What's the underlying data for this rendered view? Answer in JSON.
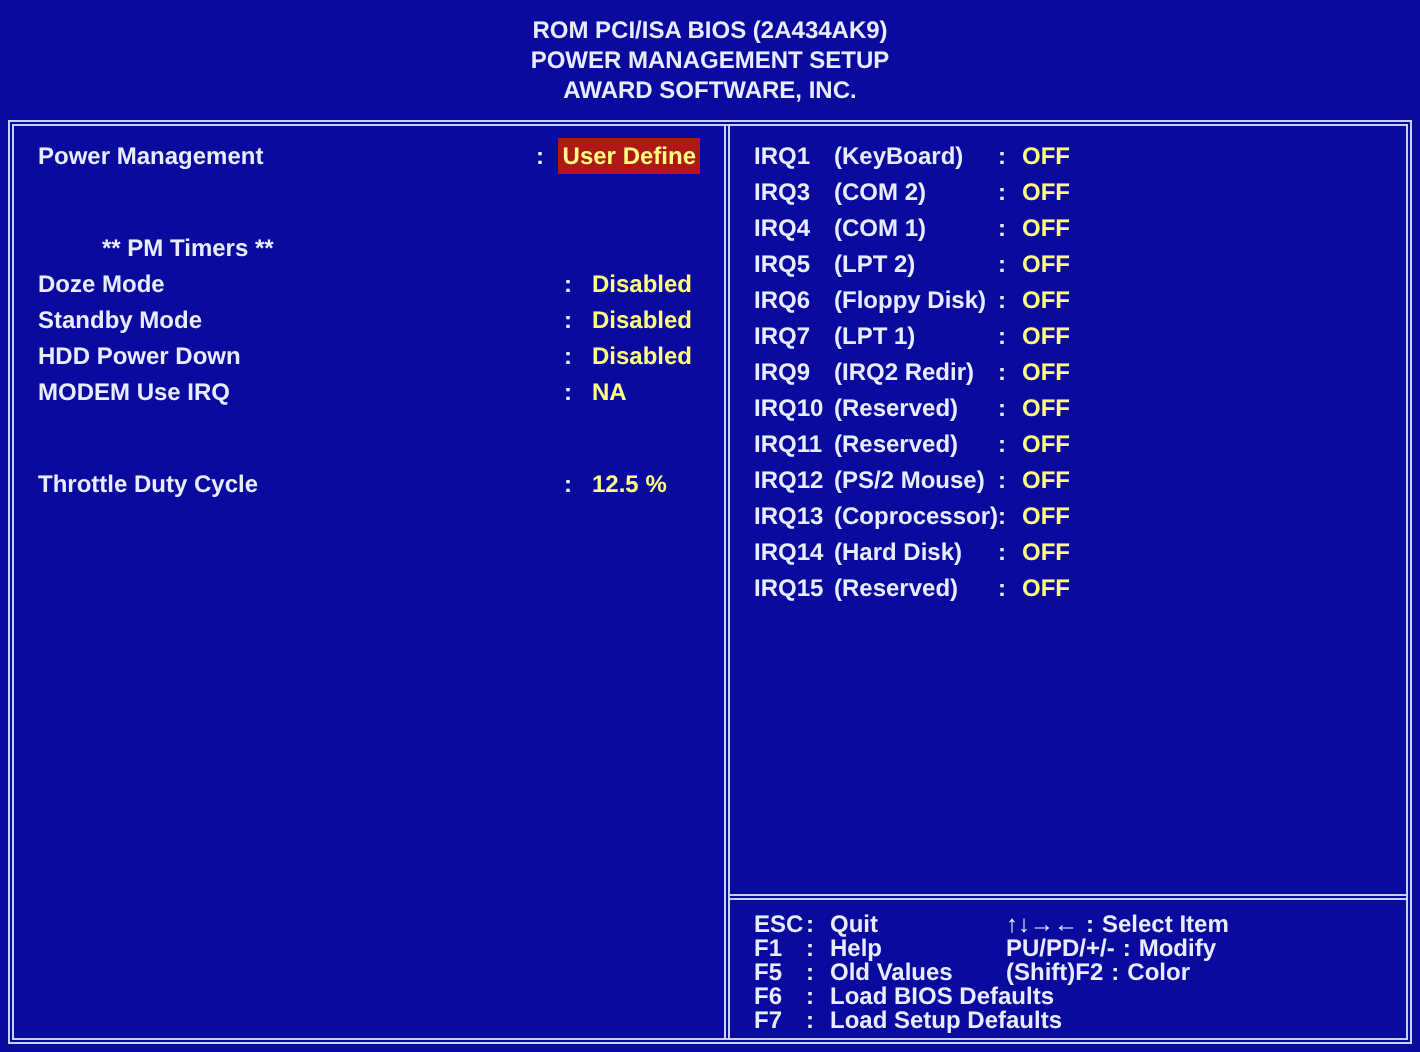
{
  "header": [
    "ROM PCI/ISA BIOS (2A434AK9)",
    "POWER MANAGEMENT SETUP",
    "AWARD SOFTWARE, INC."
  ],
  "setting_groups": [
    [
      {
        "kind": "setting",
        "label": "Power Management",
        "separator": ":",
        "value": "User Define",
        "selected": true
      }
    ],
    [
      {
        "kind": "heading",
        "label": "** PM Timers **"
      },
      {
        "kind": "setting",
        "label": "Doze Mode",
        "separator": ":",
        "value": "Disabled",
        "selected": false
      },
      {
        "kind": "setting",
        "label": "Standby Mode",
        "separator": ":",
        "value": "Disabled",
        "selected": false
      },
      {
        "kind": "setting",
        "label": "HDD Power Down",
        "separator": ":",
        "value": "Disabled",
        "selected": false
      },
      {
        "kind": "setting",
        "label": "MODEM Use IRQ",
        "separator": ":",
        "value": "NA",
        "selected": false
      }
    ],
    [
      {
        "kind": "setting",
        "label": "Throttle Duty Cycle",
        "separator": ":",
        "value": "12.5 %",
        "selected": false
      }
    ]
  ],
  "irqs": [
    {
      "irq": "IRQ1",
      "device": "(KeyBoard)",
      "separator": ":",
      "value": "OFF",
      "selected": false
    },
    {
      "irq": "IRQ3",
      "device": "(COM 2)",
      "separator": ":",
      "value": "OFF",
      "selected": false
    },
    {
      "irq": "IRQ4",
      "device": "(COM 1)",
      "separator": ":",
      "value": "OFF",
      "selected": false
    },
    {
      "irq": "IRQ5",
      "device": "(LPT 2)",
      "separator": ":",
      "value": "OFF",
      "selected": false
    },
    {
      "irq": "IRQ6",
      "device": "(Floppy Disk)",
      "separator": ":",
      "value": "OFF",
      "selected": false
    },
    {
      "irq": "IRQ7",
      "device": "(LPT 1)",
      "separator": ":",
      "value": "OFF",
      "selected": false
    },
    {
      "irq": "IRQ9",
      "device": "(IRQ2 Redir)",
      "separator": ":",
      "value": "OFF",
      "selected": false
    },
    {
      "irq": "IRQ10",
      "device": "(Reserved)",
      "separator": ":",
      "value": "OFF",
      "selected": false
    },
    {
      "irq": "IRQ11",
      "device": "(Reserved)",
      "separator": ":",
      "value": "OFF",
      "selected": false
    },
    {
      "irq": "IRQ12",
      "device": "(PS/2 Mouse)",
      "separator": ":",
      "value": "OFF",
      "selected": false
    },
    {
      "irq": "IRQ13",
      "device": "(Coprocessor)",
      "separator": ":",
      "value": "OFF",
      "selected": false
    },
    {
      "irq": "IRQ14",
      "device": "(Hard Disk)",
      "separator": ":",
      "value": "OFF",
      "selected": false
    },
    {
      "irq": "IRQ15",
      "device": "(Reserved)",
      "separator": ":",
      "value": "OFF",
      "selected": false
    }
  ],
  "help": [
    {
      "key": "ESC",
      "separator": ":",
      "action": "Quit",
      "extra_key": "↑↓→←",
      "extra_separator": ":",
      "extra_action": "Select Item"
    },
    {
      "key": "F1",
      "separator": ":",
      "action": "Help",
      "extra_key": "PU/PD/+/-",
      "extra_separator": ":",
      "extra_action": "Modify"
    },
    {
      "key": "F5",
      "separator": ":",
      "action": "Old Values",
      "extra_key": "(Shift)F2",
      "extra_separator": ":",
      "extra_action": "Color"
    },
    {
      "key": "F6",
      "separator": ":",
      "action": "Load BIOS Defaults"
    },
    {
      "key": "F7",
      "separator": ":",
      "action": "Load Setup Defaults"
    }
  ]
}
